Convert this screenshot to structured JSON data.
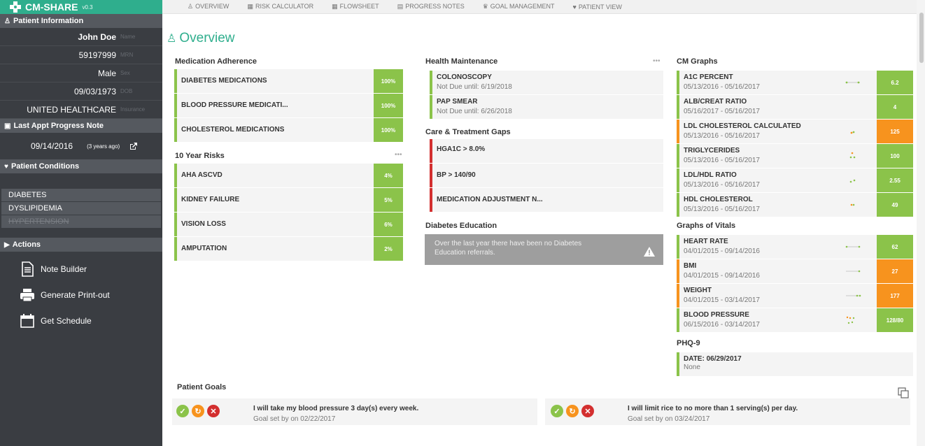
{
  "app": {
    "name": "CM-SHARE",
    "version": "v0.3"
  },
  "nav": {
    "tabs": [
      "OVERVIEW",
      "RISK CALCULATOR",
      "FLOWSHEET",
      "PROGRESS NOTES",
      "GOAL MANAGEMENT",
      "PATIENT VIEW"
    ]
  },
  "sidebar": {
    "patient_info_title": "Patient Information",
    "patient": [
      {
        "value": "John Doe",
        "label": "Name"
      },
      {
        "value": "59197999",
        "label": "MRN"
      },
      {
        "value": "Male",
        "label": "Sex"
      },
      {
        "value": "09/03/1973",
        "label": "DOB"
      },
      {
        "value": "UNITED HEALTHCARE",
        "label": "Insurance"
      }
    ],
    "last_appt_title": "Last Appt Progress Note",
    "last_appt_date": "09/14/2016",
    "last_appt_ago": "(3 years ago)",
    "conditions_title": "Patient Conditions",
    "conditions": [
      "DIABETES",
      "DYSLIPIDEMIA",
      "HYPERTENSION"
    ],
    "actions_title": "Actions",
    "actions": [
      "Note Builder",
      "Generate Print-out",
      "Get Schedule"
    ]
  },
  "page_title": "Overview",
  "med_adherence": {
    "title": "Medication Adherence",
    "items": [
      {
        "name": "DIABETES MEDICATIONS",
        "value": "100%"
      },
      {
        "name": "BLOOD PRESSURE MEDICATI...",
        "value": "100%"
      },
      {
        "name": "CHOLESTEROL MEDICATIONS",
        "value": "100%"
      }
    ]
  },
  "risks": {
    "title": "10 Year Risks",
    "items": [
      {
        "name": "AHA ASCVD",
        "value": "4%"
      },
      {
        "name": "KIDNEY FAILURE",
        "value": "5%"
      },
      {
        "name": "VISION LOSS",
        "value": "6%"
      },
      {
        "name": "AMPUTATION",
        "value": "2%"
      }
    ]
  },
  "health_maintenance": {
    "title": "Health Maintenance",
    "items": [
      {
        "name": "COLONOSCOPY",
        "sub": "Not Due until: 6/19/2018"
      },
      {
        "name": "PAP SMEAR",
        "sub": "Not Due until: 6/26/2018"
      }
    ]
  },
  "care_gaps": {
    "title": "Care & Treatment Gaps",
    "items": [
      "HGA1C > 8.0%",
      "BP > 140/90",
      "MEDICATION ADJUSTMENT N..."
    ],
    "color": "#d32f2f"
  },
  "diabetes_education": {
    "title": "Diabetes Education",
    "text": "Over the last year there have been no Diabetes Education referrals."
  },
  "cm_graphs": {
    "title": "CM Graphs",
    "items": [
      {
        "name": "A1C PERCENT",
        "range": "05/13/2016 - 05/16/2017",
        "value": "6.2",
        "status": "green"
      },
      {
        "name": "ALB/CREAT RATIO",
        "range": "05/16/2017 - 05/16/2017",
        "value": "4",
        "status": "green"
      },
      {
        "name": "LDL CHOLESTEROL CALCULATED",
        "range": "05/13/2016 - 05/16/2017",
        "value": "125",
        "status": "orange"
      },
      {
        "name": "TRIGLYCERIDES",
        "range": "05/13/2016 - 05/16/2017",
        "value": "100",
        "status": "green"
      },
      {
        "name": "LDL/HDL RATIO",
        "range": "05/13/2016 - 05/16/2017",
        "value": "2.55",
        "status": "green"
      },
      {
        "name": "HDL CHOLESTEROL",
        "range": "05/13/2016 - 05/16/2017",
        "value": "49",
        "status": "green"
      }
    ]
  },
  "vitals": {
    "title": "Graphs of Vitals",
    "items": [
      {
        "name": "HEART RATE",
        "range": "04/01/2015 - 09/14/2016",
        "value": "62",
        "status": "green"
      },
      {
        "name": "BMI",
        "range": "04/01/2015 - 09/14/2016",
        "value": "27",
        "status": "orange"
      },
      {
        "name": "WEIGHT",
        "range": "04/01/2015 - 03/14/2017",
        "value": "177",
        "status": "orange"
      },
      {
        "name": "BLOOD PRESSURE",
        "range": "06/15/2016 - 03/14/2017",
        "value": "128/80",
        "status": "green"
      }
    ]
  },
  "phq9": {
    "title": "PHQ-9",
    "date": "DATE: 06/29/2017",
    "value": "None"
  },
  "goals": {
    "title": "Patient Goals",
    "items": [
      {
        "text": "I will take my blood pressure 3 day(s) every week.",
        "sub": "Goal set by on 02/22/2017"
      },
      {
        "text": "I will limit rice to no more than 1 serving(s) per day.",
        "sub": "Goal set by on 03/24/2017"
      }
    ]
  },
  "colors": {
    "brand": "#2fae8d",
    "green": "#8bc34a",
    "orange": "#f7931e",
    "red": "#d32f2f",
    "sidebar": "#3a3d42"
  }
}
